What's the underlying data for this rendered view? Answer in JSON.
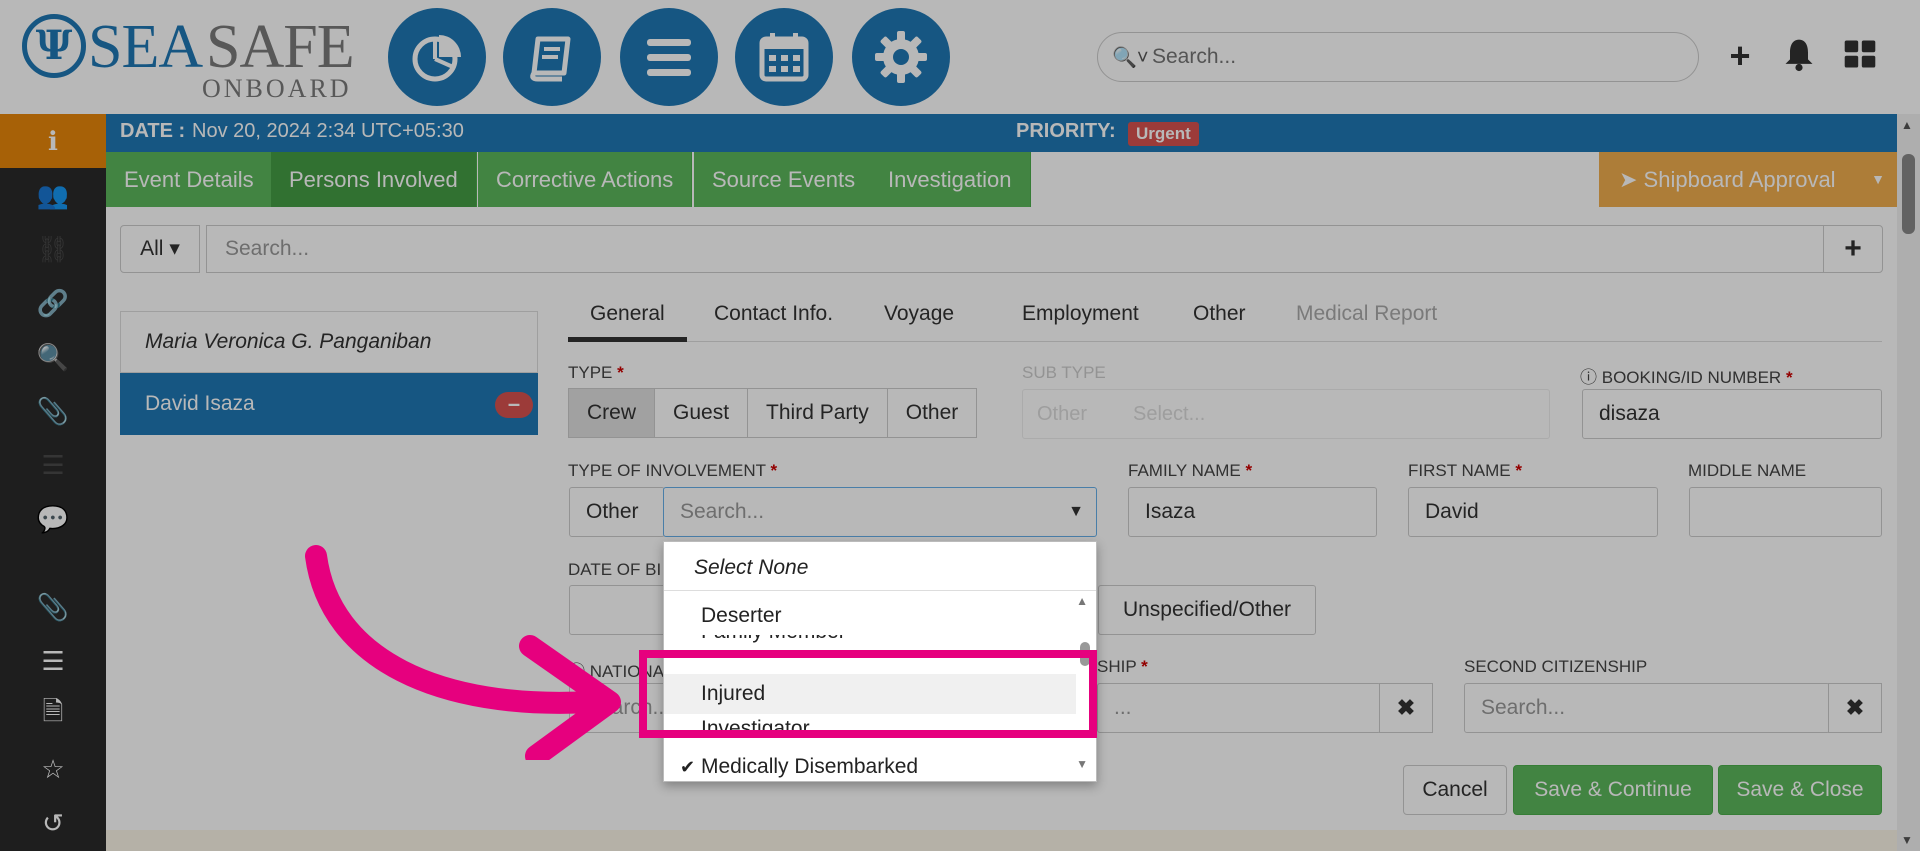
{
  "brand": {
    "emblem": "Ψ",
    "sea": "SEA",
    "safe": "SAFE",
    "onboard": "ONBOARD"
  },
  "topnav": {
    "icons": [
      "pie-chart-icon",
      "book-icon",
      "menu-icon",
      "calendar-icon",
      "gear-icon"
    ]
  },
  "global_search": {
    "placeholder": "Search..."
  },
  "header": {
    "date_label": "DATE :",
    "date_value": "Nov 20, 2024 2:34 UTC+05:30",
    "priority_label": "PRIORITY:",
    "priority_value": "Urgent"
  },
  "colors": {
    "brand_blue": "#1f78b4",
    "green": "#5cb85c",
    "orange": "#f0ad4e",
    "danger": "#d9534f",
    "highlight": "#e6007e"
  },
  "main_tabs": [
    "Event Details",
    "Persons Involved",
    "Corrective Actions",
    "Source Events",
    "Investigation"
  ],
  "approval_label": "Shipboard Approval",
  "filter": {
    "all_label": "All",
    "placeholder": "Search..."
  },
  "persons": [
    {
      "name": "Maria Veronica G. Panganiban"
    },
    {
      "name": "David Isaza"
    }
  ],
  "sub_tabs": [
    "General",
    "Contact Info.",
    "Voyage",
    "Employment",
    "Other",
    "Medical Report"
  ],
  "form": {
    "type_label": "TYPE",
    "type_options": [
      "Crew",
      "Guest",
      "Third Party",
      "Other"
    ],
    "sub_type_label": "SUB TYPE",
    "sub_type_other": "Other",
    "sub_type_placeholder": "Select...",
    "booking_label": "BOOKING/ID NUMBER",
    "booking_value": "disaza",
    "involvement_label": "TYPE OF INVOLVEMENT",
    "involvement_prefix": "Other",
    "involvement_placeholder": "Search...",
    "family_name_label": "FAMILY NAME",
    "family_name_value": "Isaza",
    "first_name_label": "FIRST NAME",
    "first_name_value": "David",
    "middle_name_label": "MIDDLE NAME",
    "dob_label": "DATE OF BI",
    "gender_option": "Unspecified/Other",
    "nationality_label": "NATIONA",
    "nationality_placeholder": "Search...",
    "citizenship_label": "SHIP",
    "citizenship_placeholder": "...",
    "second_citizenship_label": "SECOND CITIZENSHIP",
    "second_citizenship_placeholder": "Search..."
  },
  "dropdown": {
    "select_none": "Select None",
    "options": [
      "Deserter",
      "Family Member",
      "Injured",
      "Investigator",
      "Medically Disembarked"
    ]
  },
  "buttons": {
    "cancel": "Cancel",
    "save_continue": "Save & Continue",
    "save_close": "Save & Close"
  }
}
